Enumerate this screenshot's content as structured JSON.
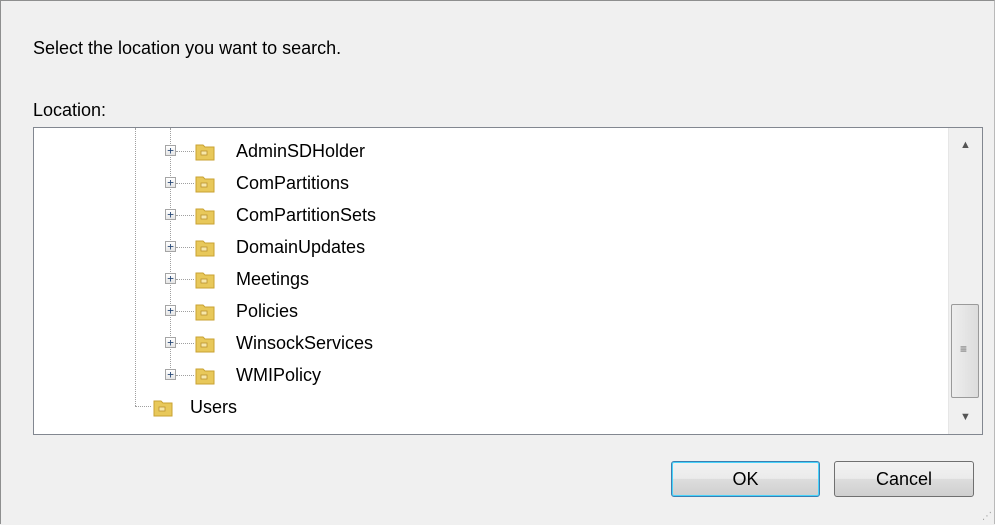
{
  "dialog": {
    "prompt": "Select the location you want to search.",
    "location_label": "Location:"
  },
  "tree": {
    "items": [
      {
        "label": "AdminSDHolder",
        "expander": "+"
      },
      {
        "label": "ComPartitions",
        "expander": "+"
      },
      {
        "label": "ComPartitionSets",
        "expander": "+"
      },
      {
        "label": "DomainUpdates",
        "expander": "+"
      },
      {
        "label": "Meetings",
        "expander": "+"
      },
      {
        "label": "Policies",
        "expander": "+"
      },
      {
        "label": "WinsockServices",
        "expander": "+"
      },
      {
        "label": "WMIPolicy",
        "expander": "+"
      }
    ],
    "users": {
      "label": "Users"
    }
  },
  "scrollbar": {
    "up": "▲",
    "down": "▼",
    "grip": "≡"
  },
  "buttons": {
    "ok": "OK",
    "cancel": "Cancel"
  },
  "colors": {
    "folder": "#e8c85a",
    "folder_dark": "#c9a232",
    "focus": "#3c7fb1"
  }
}
